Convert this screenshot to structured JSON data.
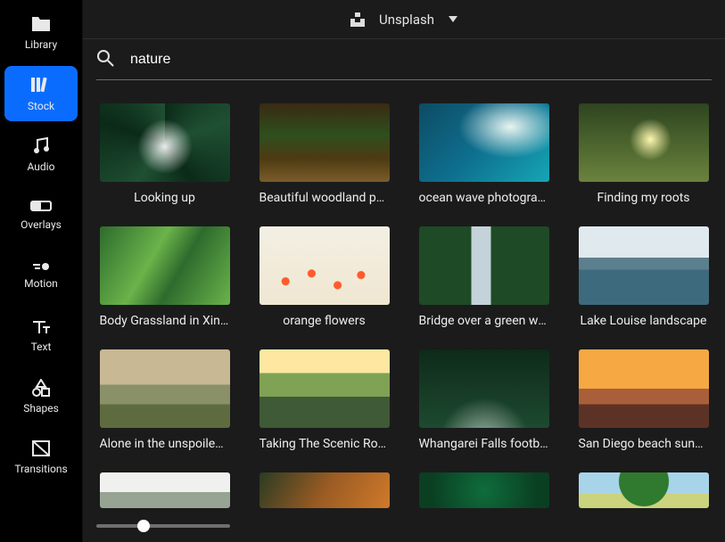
{
  "header": {
    "source": "Unsplash"
  },
  "search": {
    "value": "nature"
  },
  "sidebar": {
    "items": [
      {
        "id": "library",
        "label": "Library"
      },
      {
        "id": "stock",
        "label": "Stock"
      },
      {
        "id": "audio",
        "label": "Audio"
      },
      {
        "id": "overlays",
        "label": "Overlays"
      },
      {
        "id": "motion",
        "label": "Motion"
      },
      {
        "id": "text",
        "label": "Text"
      },
      {
        "id": "shapes",
        "label": "Shapes"
      },
      {
        "id": "transitions",
        "label": "Transitions"
      }
    ],
    "active": "stock"
  },
  "results": [
    {
      "caption": "Looking up",
      "thumb": "tree-up"
    },
    {
      "caption": "Beautiful woodland path",
      "thumb": "woodland"
    },
    {
      "caption": "ocean wave photography",
      "thumb": "ocean"
    },
    {
      "caption": "Finding my roots",
      "thumb": "roots"
    },
    {
      "caption": "Body Grassland in Xinjiang",
      "thumb": "grassland"
    },
    {
      "caption": "orange flowers",
      "thumb": "poppies"
    },
    {
      "caption": "Bridge over a green waterfall",
      "thumb": "waterfall"
    },
    {
      "caption": "Lake Louise landscape",
      "thumb": "lake"
    },
    {
      "caption": "Alone in the unspoiled wilderness",
      "thumb": "alone"
    },
    {
      "caption": "Taking The Scenic Route",
      "thumb": "scenic"
    },
    {
      "caption": "Whangarei Falls footbridge",
      "thumb": "falls"
    },
    {
      "caption": "San Diego beach sunset",
      "thumb": "beach"
    },
    {
      "caption": "",
      "thumb": "fog",
      "partial": true
    },
    {
      "caption": "",
      "thumb": "autumn",
      "partial": true
    },
    {
      "caption": "",
      "thumb": "ferns",
      "partial": true
    },
    {
      "caption": "",
      "thumb": "bigtree",
      "partial": true
    }
  ],
  "slider": {
    "value": 35
  }
}
